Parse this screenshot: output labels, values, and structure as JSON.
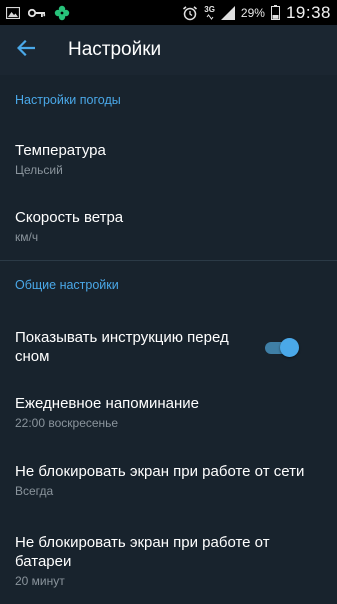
{
  "status_bar": {
    "left_icons": [
      "image-icon",
      "key-icon",
      "clover-icon"
    ],
    "network": "3G",
    "battery_percent": "29%",
    "time": "19:38"
  },
  "app_bar": {
    "title": "Настройки"
  },
  "sections": [
    {
      "header": "Настройки погоды",
      "items": [
        {
          "title": "Температура",
          "summary": "Цельсий"
        },
        {
          "title": "Скорость ветра",
          "summary": "км/ч"
        }
      ]
    },
    {
      "header": "Общие настройки",
      "items": [
        {
          "title": "Показывать инструкцию перед сном",
          "toggle_on": true
        },
        {
          "title": "Ежедневное напоминание",
          "summary": "22:00 воскресенье"
        },
        {
          "title": "Не блокировать экран при работе от сети",
          "summary": "Всегда"
        },
        {
          "title": "Не блокировать экран при работе от батареи",
          "summary": "20 минут"
        }
      ]
    }
  ],
  "colors": {
    "accent": "#4aa8e8",
    "background": "#18232d",
    "summary_text": "#8a949c"
  }
}
